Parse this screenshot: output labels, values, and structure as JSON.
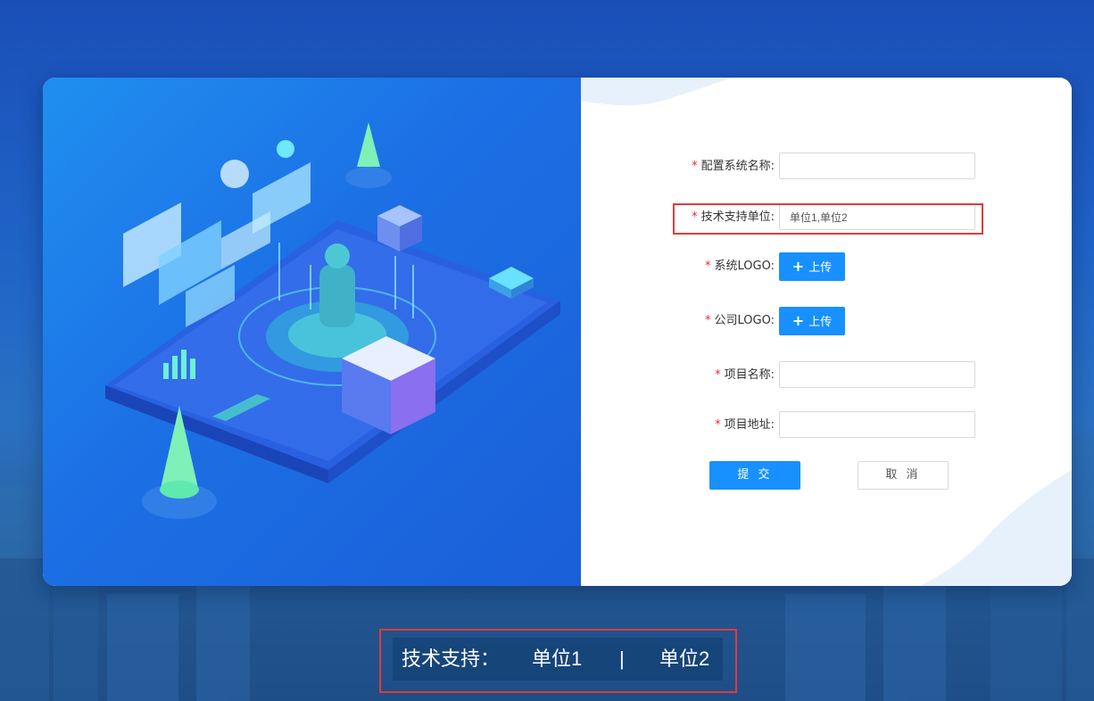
{
  "form": {
    "fields": [
      {
        "label": "配置系统名称:",
        "value": ""
      },
      {
        "label": "技术支持单位:",
        "value": "单位1,单位2"
      },
      {
        "label": "系统LOGO:",
        "upload_label": "上传"
      },
      {
        "label": "公司LOGO:",
        "upload_label": "上传"
      },
      {
        "label": "项目名称:",
        "value": ""
      },
      {
        "label": "项目地址:",
        "value": ""
      }
    ],
    "required_mark": "*",
    "submit_label": "提 交",
    "cancel_label": "取 消",
    "upload_icon": "plus-icon"
  },
  "footer": {
    "prefix": "技术支持：",
    "unit1": "单位1",
    "separator": "|",
    "unit2": "单位2"
  },
  "colors": {
    "primary": "#1890ff",
    "required": "#f5222d",
    "highlight": "#e03a3a"
  }
}
